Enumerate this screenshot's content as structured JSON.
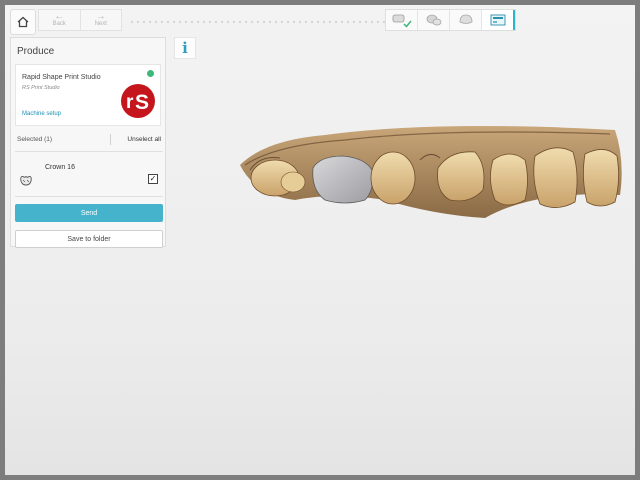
{
  "toolbar": {
    "back_label": "Back",
    "next_label": "Next",
    "icons": [
      "home-icon",
      "arrow-left-icon",
      "arrow-right-icon"
    ]
  },
  "workflow_steps": [
    {
      "name": "scan-step",
      "status": "completed"
    },
    {
      "name": "design-step",
      "status": "pending"
    },
    {
      "name": "model-step",
      "status": "pending"
    },
    {
      "name": "produce-step",
      "status": "active"
    }
  ],
  "panel": {
    "title": "Produce",
    "device": {
      "name": "Rapid Shape Print Studio",
      "subtitle": "RS Print Studio",
      "setup_link": "Machine setup",
      "status_color": "#3cb878"
    },
    "selected_label": "Selected (1)",
    "unselect_label": "Unselect all",
    "items": [
      {
        "label": "Crown 16",
        "checked": true
      }
    ],
    "send_label": "Send",
    "save_label": "Save to folder"
  },
  "colors": {
    "accent": "#46b3cd",
    "link": "#1d8fb3",
    "logo_red": "#c4161c"
  }
}
